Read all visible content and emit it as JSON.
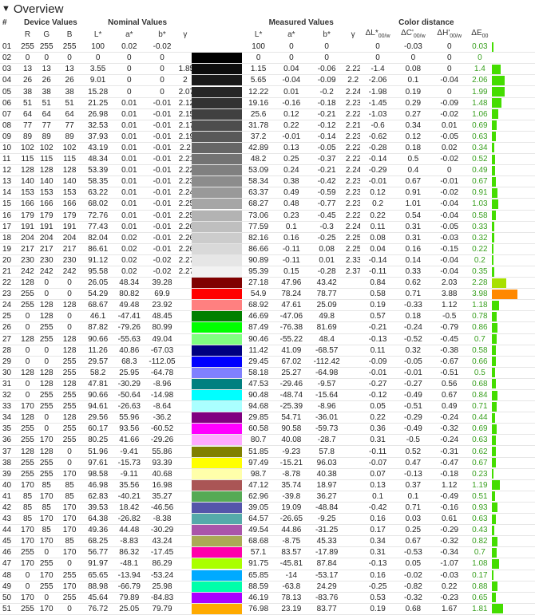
{
  "section": {
    "title": "Overview",
    "toggle_icon": "triangle-down-icon"
  },
  "groups": {
    "device": "Device Values",
    "nominal": "Nominal Values",
    "measured": "Measured Values",
    "distance": "Color distance"
  },
  "columns": {
    "idx": "#",
    "R": "R",
    "G": "G",
    "B": "B",
    "nom_L": "L*",
    "nom_a": "a*",
    "nom_b": "b*",
    "nom_g": "γ",
    "meas_L": "L*",
    "meas_a": "a*",
    "meas_b": "b*",
    "meas_g": "γ",
    "dL": "ΔL*",
    "dL_sub": "00/w",
    "dC": "ΔC'",
    "dC_sub": "00/w",
    "dH": "ΔH'",
    "dH_sub": "00/w",
    "dE": "ΔE",
    "dE_sub": "00"
  },
  "colors": {
    "delta_ok": "#3aa020",
    "bar_green": "#44dd00",
    "bar_yellowgreen": "#a8e000",
    "bar_orange": "#ff8800"
  },
  "rows": [
    [
      "01",
      "255",
      "255",
      "255",
      "100",
      "0.02",
      "-0.02",
      "",
      "#ffffff",
      "100",
      "0",
      "0",
      "",
      "0",
      "-0.03",
      "0",
      "0.03"
    ],
    [
      "02",
      "0",
      "0",
      "0",
      "0",
      "0",
      "0",
      "",
      "#000000",
      "0",
      "0",
      "0",
      "",
      "0",
      "0",
      "0",
      "0"
    ],
    [
      "03",
      "13",
      "13",
      "13",
      "3.55",
      "0",
      "0",
      "1.85",
      "#0d0d0d",
      "1.15",
      "0.04",
      "-0.06",
      "2.22",
      "-1.4",
      "0.08",
      "0",
      "1.4"
    ],
    [
      "04",
      "26",
      "26",
      "26",
      "9.01",
      "0",
      "0",
      "2",
      "#1a1a1a",
      "5.65",
      "-0.04",
      "-0.09",
      "2.2",
      "-2.06",
      "0.1",
      "-0.04",
      "2.06"
    ],
    [
      "05",
      "38",
      "38",
      "38",
      "15.28",
      "0",
      "0",
      "2.07",
      "#262626",
      "12.22",
      "0.01",
      "-0.2",
      "2.24",
      "-1.98",
      "0.19",
      "0",
      "1.99"
    ],
    [
      "06",
      "51",
      "51",
      "51",
      "21.25",
      "0.01",
      "-0.01",
      "2.12",
      "#333333",
      "19.16",
      "-0.16",
      "-0.18",
      "2.23",
      "-1.45",
      "0.29",
      "-0.09",
      "1.48"
    ],
    [
      "07",
      "64",
      "64",
      "64",
      "26.98",
      "0.01",
      "-0.01",
      "2.15",
      "#404040",
      "25.6",
      "0.12",
      "-0.21",
      "2.22",
      "-1.03",
      "0.27",
      "-0.02",
      "1.06"
    ],
    [
      "08",
      "77",
      "77",
      "77",
      "32.53",
      "0.01",
      "-0.01",
      "2.17",
      "#4d4d4d",
      "31.78",
      "0.22",
      "-0.12",
      "2.21",
      "-0.6",
      "0.34",
      "0.01",
      "0.69"
    ],
    [
      "09",
      "89",
      "89",
      "89",
      "37.93",
      "0.01",
      "-0.01",
      "2.19",
      "#595959",
      "37.2",
      "-0.01",
      "-0.14",
      "2.23",
      "-0.62",
      "0.12",
      "-0.05",
      "0.63"
    ],
    [
      "10",
      "102",
      "102",
      "102",
      "43.19",
      "0.01",
      "-0.01",
      "2.2",
      "#666666",
      "42.89",
      "0.13",
      "-0.05",
      "2.22",
      "-0.28",
      "0.18",
      "0.02",
      "0.34"
    ],
    [
      "11",
      "115",
      "115",
      "115",
      "48.34",
      "0.01",
      "-0.01",
      "2.21",
      "#737373",
      "48.2",
      "0.25",
      "-0.37",
      "2.22",
      "-0.14",
      "0.5",
      "-0.02",
      "0.52"
    ],
    [
      "12",
      "128",
      "128",
      "128",
      "53.39",
      "0.01",
      "-0.01",
      "2.22",
      "#808080",
      "53.09",
      "0.24",
      "-0.21",
      "2.24",
      "-0.29",
      "0.4",
      "0",
      "0.49"
    ],
    [
      "13",
      "140",
      "140",
      "140",
      "58.35",
      "0.01",
      "-0.01",
      "2.23",
      "#8c8c8c",
      "58.34",
      "0.38",
      "-0.42",
      "2.23",
      "-0.01",
      "0.67",
      "-0.01",
      "0.67"
    ],
    [
      "14",
      "153",
      "153",
      "153",
      "63.22",
      "0.01",
      "-0.01",
      "2.24",
      "#999999",
      "63.37",
      "0.49",
      "-0.59",
      "2.23",
      "0.12",
      "0.91",
      "-0.02",
      "0.91"
    ],
    [
      "15",
      "166",
      "166",
      "166",
      "68.02",
      "0.01",
      "-0.01",
      "2.25",
      "#a6a6a6",
      "68.27",
      "0.48",
      "-0.77",
      "2.23",
      "0.2",
      "1.01",
      "-0.04",
      "1.03"
    ],
    [
      "16",
      "179",
      "179",
      "179",
      "72.76",
      "0.01",
      "-0.01",
      "2.25",
      "#b3b3b3",
      "73.06",
      "0.23",
      "-0.45",
      "2.22",
      "0.22",
      "0.54",
      "-0.04",
      "0.58"
    ],
    [
      "17",
      "191",
      "191",
      "191",
      "77.43",
      "0.01",
      "-0.01",
      "2.26",
      "#bfbfbf",
      "77.59",
      "0.1",
      "-0.3",
      "2.24",
      "0.11",
      "0.31",
      "-0.05",
      "0.33"
    ],
    [
      "18",
      "204",
      "204",
      "204",
      "82.04",
      "0.02",
      "-0.01",
      "2.26",
      "#cccccc",
      "82.16",
      "0.16",
      "-0.25",
      "2.25",
      "0.08",
      "0.31",
      "-0.03",
      "0.32"
    ],
    [
      "19",
      "217",
      "217",
      "217",
      "86.61",
      "0.02",
      "-0.01",
      "2.26",
      "#d9d9d9",
      "86.66",
      "-0.11",
      "0.08",
      "2.25",
      "0.04",
      "0.16",
      "-0.15",
      "0.22"
    ],
    [
      "20",
      "230",
      "230",
      "230",
      "91.12",
      "0.02",
      "-0.02",
      "2.27",
      "#e6e6e6",
      "90.89",
      "-0.11",
      "0.01",
      "2.33",
      "-0.14",
      "0.14",
      "-0.04",
      "0.2"
    ],
    [
      "21",
      "242",
      "242",
      "242",
      "95.58",
      "0.02",
      "-0.02",
      "2.27",
      "#f2f2f2",
      "95.39",
      "0.15",
      "-0.28",
      "2.37",
      "-0.11",
      "0.33",
      "-0.04",
      "0.35"
    ],
    [
      "22",
      "128",
      "0",
      "0",
      "26.05",
      "48.34",
      "39.28",
      "",
      "#800000",
      "27.18",
      "47.96",
      "43.42",
      "",
      "0.84",
      "0.62",
      "2.03",
      "2.28"
    ],
    [
      "23",
      "255",
      "0",
      "0",
      "54.29",
      "80.82",
      "69.9",
      "",
      "#ff0000",
      "54.9",
      "78.24",
      "78.77",
      "",
      "0.58",
      "0.71",
      "3.88",
      "3.98"
    ],
    [
      "24",
      "255",
      "128",
      "128",
      "68.67",
      "49.48",
      "23.92",
      "",
      "#ff8080",
      "68.92",
      "47.61",
      "25.09",
      "",
      "0.19",
      "-0.33",
      "1.12",
      "1.18"
    ],
    [
      "25",
      "0",
      "128",
      "0",
      "46.1",
      "-47.41",
      "48.45",
      "",
      "#008000",
      "46.69",
      "-47.06",
      "49.8",
      "",
      "0.57",
      "0.18",
      "-0.5",
      "0.78"
    ],
    [
      "26",
      "0",
      "255",
      "0",
      "87.82",
      "-79.26",
      "80.99",
      "",
      "#00ff00",
      "87.49",
      "-76.38",
      "81.69",
      "",
      "-0.21",
      "-0.24",
      "-0.79",
      "0.86"
    ],
    [
      "27",
      "128",
      "255",
      "128",
      "90.66",
      "-55.63",
      "49.04",
      "",
      "#80ff80",
      "90.46",
      "-55.22",
      "48.4",
      "",
      "-0.13",
      "-0.52",
      "-0.45",
      "0.7"
    ],
    [
      "28",
      "0",
      "0",
      "128",
      "11.26",
      "40.86",
      "-67.03",
      "",
      "#000080",
      "11.42",
      "41.09",
      "-68.57",
      "",
      "0.11",
      "0.32",
      "-0.38",
      "0.58"
    ],
    [
      "29",
      "0",
      "0",
      "255",
      "29.57",
      "68.3",
      "-112.05",
      "",
      "#0000ff",
      "29.45",
      "67.02",
      "-112.42",
      "",
      "-0.09",
      "-0.05",
      "-0.67",
      "0.66"
    ],
    [
      "30",
      "128",
      "128",
      "255",
      "58.2",
      "25.95",
      "-64.78",
      "",
      "#8080ff",
      "58.18",
      "25.27",
      "-64.98",
      "",
      "-0.01",
      "-0.01",
      "-0.51",
      "0.5"
    ],
    [
      "31",
      "0",
      "128",
      "128",
      "47.81",
      "-30.29",
      "-8.96",
      "",
      "#008080",
      "47.53",
      "-29.46",
      "-9.57",
      "",
      "-0.27",
      "-0.27",
      "0.56",
      "0.68"
    ],
    [
      "32",
      "0",
      "255",
      "255",
      "90.66",
      "-50.64",
      "-14.98",
      "",
      "#00ffff",
      "90.48",
      "-48.74",
      "-15.64",
      "",
      "-0.12",
      "-0.49",
      "0.67",
      "0.84"
    ],
    [
      "33",
      "170",
      "255",
      "255",
      "94.61",
      "-26.63",
      "-8.64",
      "",
      "#aaffff",
      "94.68",
      "-25.39",
      "-8.96",
      "",
      "0.05",
      "-0.51",
      "0.49",
      "0.71"
    ],
    [
      "34",
      "128",
      "0",
      "128",
      "29.56",
      "55.96",
      "-36.2",
      "",
      "#800080",
      "29.85",
      "54.71",
      "-36.01",
      "",
      "0.22",
      "-0.29",
      "-0.24",
      "0.44"
    ],
    [
      "35",
      "255",
      "0",
      "255",
      "60.17",
      "93.56",
      "-60.52",
      "",
      "#ff00ff",
      "60.58",
      "90.58",
      "-59.73",
      "",
      "0.36",
      "-0.49",
      "-0.32",
      "0.69"
    ],
    [
      "36",
      "255",
      "170",
      "255",
      "80.25",
      "41.66",
      "-29.26",
      "",
      "#ffaaff",
      "80.7",
      "40.08",
      "-28.7",
      "",
      "0.31",
      "-0.5",
      "-0.24",
      "0.63"
    ],
    [
      "37",
      "128",
      "128",
      "0",
      "51.96",
      "-9.41",
      "55.86",
      "",
      "#808000",
      "51.85",
      "-9.23",
      "57.8",
      "",
      "-0.11",
      "0.52",
      "-0.31",
      "0.62"
    ],
    [
      "38",
      "255",
      "255",
      "0",
      "97.61",
      "-15.73",
      "93.39",
      "",
      "#ffff00",
      "97.49",
      "-15.21",
      "96.03",
      "",
      "-0.07",
      "0.47",
      "-0.47",
      "0.67"
    ],
    [
      "39",
      "255",
      "255",
      "170",
      "98.58",
      "-9.11",
      "40.68",
      "",
      "#ffffaa",
      "98.7",
      "-8.78",
      "40.38",
      "",
      "0.07",
      "-0.13",
      "-0.18",
      "0.23"
    ],
    [
      "40",
      "170",
      "85",
      "85",
      "46.98",
      "35.56",
      "16.98",
      "",
      "#aa5555",
      "47.12",
      "35.74",
      "18.97",
      "",
      "0.13",
      "0.37",
      "1.12",
      "1.19"
    ],
    [
      "41",
      "85",
      "170",
      "85",
      "62.83",
      "-40.21",
      "35.27",
      "",
      "#55aa55",
      "62.96",
      "-39.8",
      "36.27",
      "",
      "0.1",
      "0.1",
      "-0.49",
      "0.51"
    ],
    [
      "42",
      "85",
      "85",
      "170",
      "39.53",
      "18.42",
      "-46.56",
      "",
      "#5555aa",
      "39.05",
      "19.09",
      "-48.84",
      "",
      "-0.42",
      "0.71",
      "-0.16",
      "0.93"
    ],
    [
      "43",
      "85",
      "170",
      "170",
      "64.38",
      "-26.82",
      "-8.38",
      "",
      "#55aaaa",
      "64.57",
      "-26.65",
      "-9.25",
      "",
      "0.16",
      "0.03",
      "0.61",
      "0.63"
    ],
    [
      "44",
      "170",
      "85",
      "170",
      "49.36",
      "44.48",
      "-30.29",
      "",
      "#aa55aa",
      "49.54",
      "44.86",
      "-31.25",
      "",
      "0.17",
      "0.25",
      "-0.29",
      "0.43"
    ],
    [
      "45",
      "170",
      "170",
      "85",
      "68.25",
      "-8.83",
      "43.24",
      "",
      "#aaaa55",
      "68.68",
      "-8.75",
      "45.33",
      "",
      "0.34",
      "0.67",
      "-0.32",
      "0.82"
    ],
    [
      "46",
      "255",
      "0",
      "170",
      "56.77",
      "86.32",
      "-17.45",
      "",
      "#ff00aa",
      "57.1",
      "83.57",
      "-17.89",
      "",
      "0.31",
      "-0.53",
      "-0.34",
      "0.7"
    ],
    [
      "47",
      "170",
      "255",
      "0",
      "91.97",
      "-48.1",
      "86.29",
      "",
      "#aaff00",
      "91.75",
      "-45.81",
      "87.84",
      "",
      "-0.13",
      "0.05",
      "-1.07",
      "1.08"
    ],
    [
      "48",
      "0",
      "170",
      "255",
      "65.65",
      "-13.94",
      "-53.24",
      "",
      "#00aaff",
      "65.85",
      "-14",
      "-53.17",
      "",
      "0.16",
      "-0.02",
      "-0.03",
      "0.17"
    ],
    [
      "49",
      "0",
      "255",
      "170",
      "88.98",
      "-66.79",
      "25.98",
      "",
      "#00ffaa",
      "88.59",
      "-63.8",
      "24.29",
      "",
      "-0.25",
      "-0.82",
      "0.22",
      "0.88"
    ],
    [
      "50",
      "170",
      "0",
      "255",
      "45.64",
      "79.89",
      "-84.83",
      "",
      "#aa00ff",
      "46.19",
      "78.13",
      "-83.76",
      "",
      "0.53",
      "-0.32",
      "-0.23",
      "0.65"
    ],
    [
      "51",
      "255",
      "170",
      "0",
      "76.72",
      "25.05",
      "79.79",
      "",
      "#ffaa00",
      "76.98",
      "23.19",
      "83.77",
      "",
      "0.19",
      "0.68",
      "1.67",
      "1.81"
    ]
  ]
}
